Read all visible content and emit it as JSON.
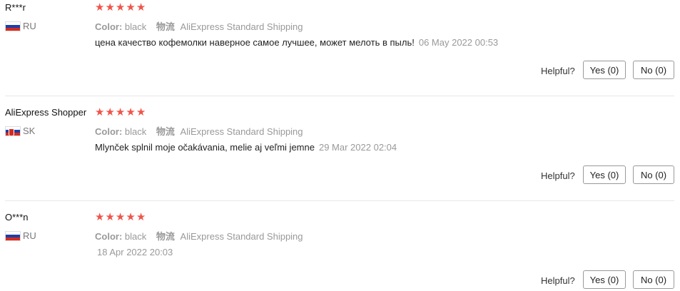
{
  "reviews": [
    {
      "user": "R***r",
      "country": "RU",
      "flag_icon": "russia-flag-icon",
      "rating": 5,
      "stars": [
        "★",
        "★",
        "★",
        "★",
        "★"
      ],
      "color_label": "Color:",
      "color_value": "black",
      "shipping_label": "物流",
      "shipping_value": "AliExpress Standard Shipping",
      "text": "цена качество кофемолки наверное самое лучшее, может мелоть в пыль!",
      "date": "06 May 2022 00:53",
      "helpful_label": "Helpful?",
      "yes_label": "Yes (0)",
      "no_label": "No (0)"
    },
    {
      "user": "AliExpress Shopper",
      "country": "SK",
      "flag_icon": "slovakia-flag-icon",
      "rating": 5,
      "stars": [
        "★",
        "★",
        "★",
        "★",
        "★"
      ],
      "color_label": "Color:",
      "color_value": "black",
      "shipping_label": "物流",
      "shipping_value": "AliExpress Standard Shipping",
      "text": "Mlynček splnil moje očakávania, melie aj veľmi jemne",
      "date": "29 Mar 2022 02:04",
      "helpful_label": "Helpful?",
      "yes_label": "Yes (0)",
      "no_label": "No (0)"
    },
    {
      "user": "O***n",
      "country": "RU",
      "flag_icon": "russia-flag-icon",
      "rating": 5,
      "stars": [
        "★",
        "★",
        "★",
        "★",
        "★"
      ],
      "color_label": "Color:",
      "color_value": "black",
      "shipping_label": "物流",
      "shipping_value": "AliExpress Standard Shipping",
      "text": "",
      "date": "18 Apr 2022 20:03",
      "helpful_label": "Helpful?",
      "yes_label": "Yes (0)",
      "no_label": "No (0)"
    }
  ],
  "colors": {
    "star": "#f0544b",
    "muted": "#999999",
    "divider": "#e8e8e8"
  }
}
